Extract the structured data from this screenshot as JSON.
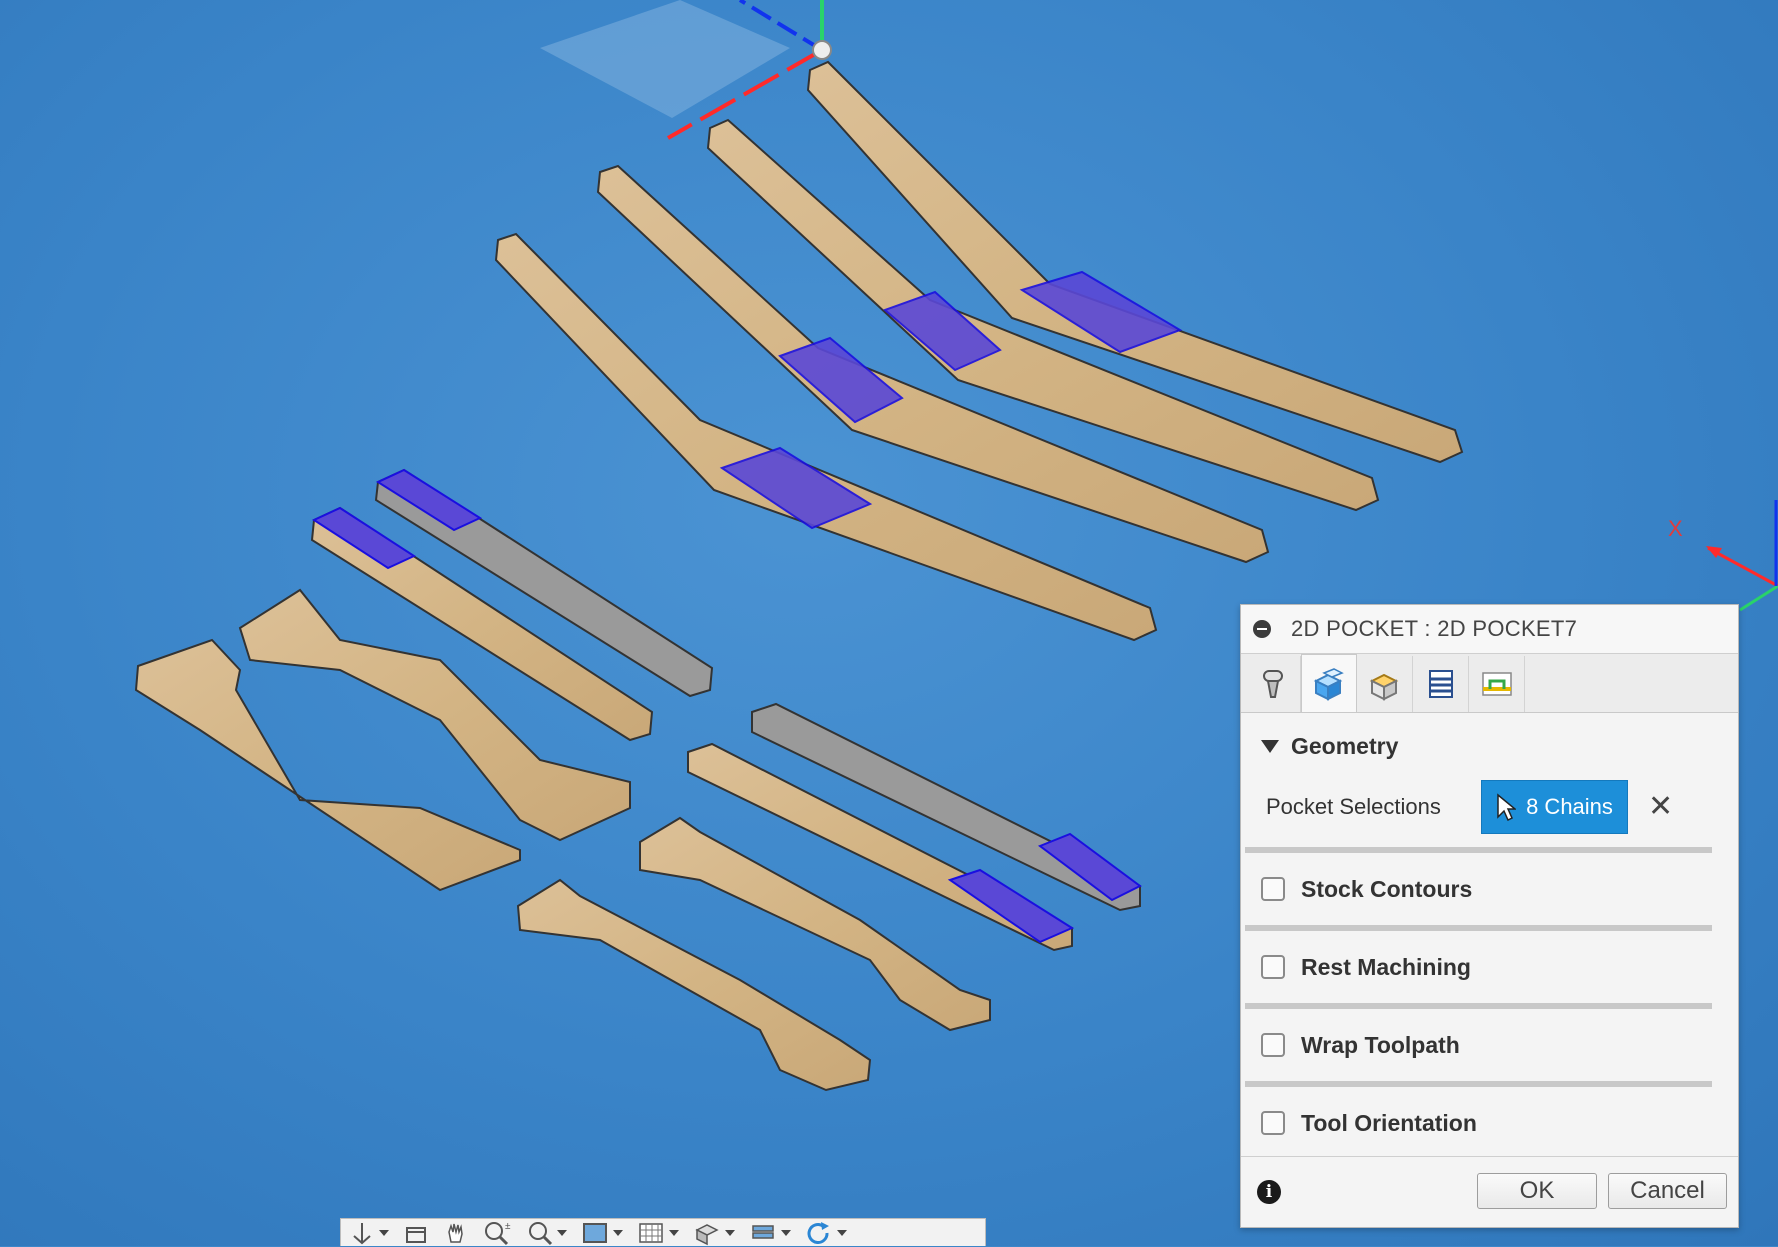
{
  "dialog": {
    "title": "2D POCKET : 2D POCKET7",
    "tabs": [
      {
        "icon": "tool-icon"
      },
      {
        "icon": "geometry-icon"
      },
      {
        "icon": "heights-icon"
      },
      {
        "icon": "passes-icon"
      },
      {
        "icon": "linking-icon"
      }
    ],
    "geometry": {
      "label": "Geometry",
      "pocket_selections_label": "Pocket Selections",
      "chains_value": "8 Chains"
    },
    "options": [
      {
        "label": "Stock Contours",
        "checked": false
      },
      {
        "label": "Rest Machining",
        "checked": false
      },
      {
        "label": "Wrap Toolpath",
        "checked": false
      },
      {
        "label": "Tool Orientation",
        "checked": false
      }
    ],
    "ok_label": "OK",
    "cancel_label": "Cancel"
  },
  "axis": {
    "x_label": "X"
  },
  "colors": {
    "viewport_bg": "#3b86c9",
    "wood": "#d8b98a",
    "selection": "#5a48d6",
    "accent": "#1d8fd9"
  }
}
